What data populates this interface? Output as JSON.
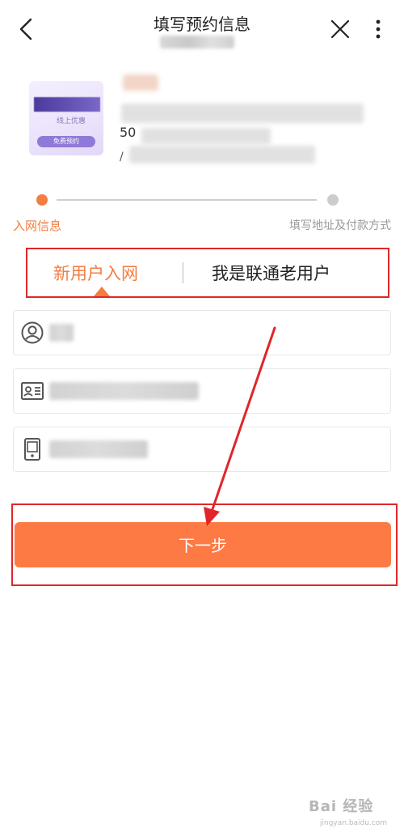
{
  "header": {
    "title": "填写预约信息"
  },
  "product": {
    "thumb_label": "线上优惠",
    "thumb_button": "免费预约",
    "number_fragment": "50",
    "slash_fragment": "/"
  },
  "steps": [
    {
      "label": "入网信息",
      "active": true
    },
    {
      "label": "填写地址及付款方式",
      "active": false
    }
  ],
  "tabs": [
    {
      "label": "新用户入网",
      "active": true
    },
    {
      "label": "我是联通老用户",
      "active": false
    }
  ],
  "fields": [
    {
      "icon": "user-icon"
    },
    {
      "icon": "id-card-icon"
    },
    {
      "icon": "phone-icon"
    }
  ],
  "actions": {
    "next_label": "下一步"
  },
  "watermark": {
    "text": "Bai 经验",
    "url": "jingyan.baidu.com"
  },
  "colors": {
    "accent": "#f37d43",
    "button": "#fd7a45",
    "annotation": "#e0262a"
  }
}
